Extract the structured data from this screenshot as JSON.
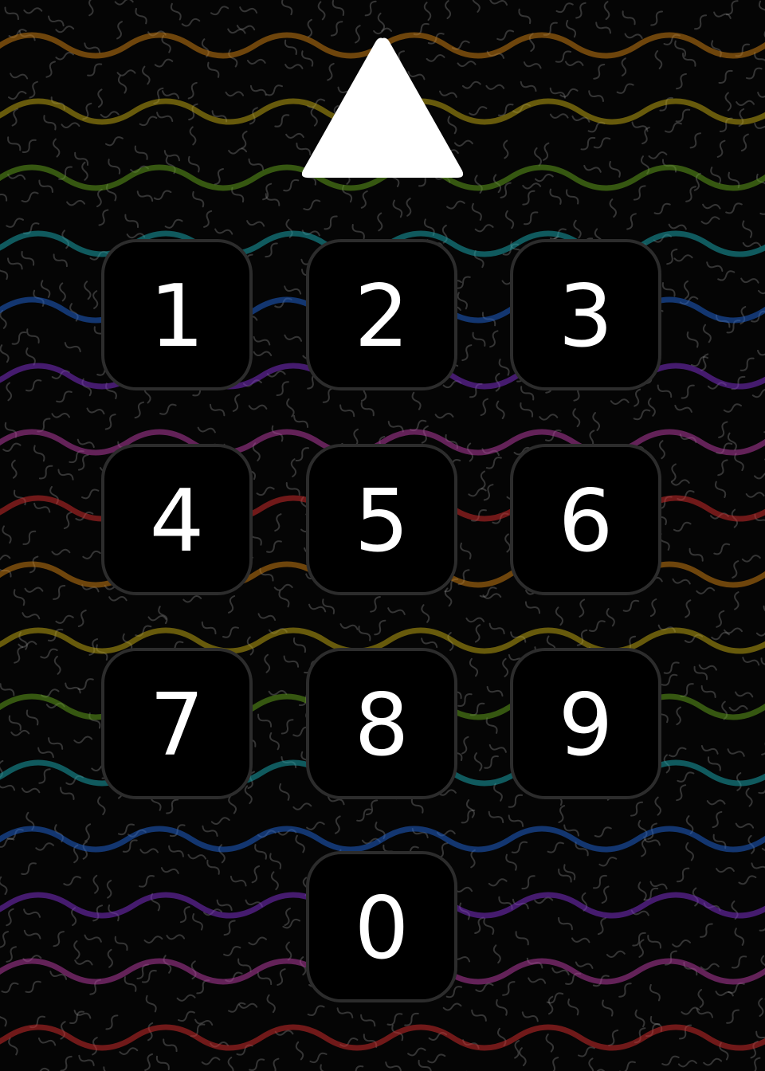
{
  "background": {
    "wave_colors": [
      "#c47a12",
      "#b8a012",
      "#5e9a1c",
      "#1aa0a8",
      "#1f5fc8",
      "#7a2ec4",
      "#b03a9c",
      "#c82a2a",
      "#c47a12",
      "#b8a012",
      "#5e9a1c",
      "#1aa0a8",
      "#1f5fc8",
      "#7a2ec4",
      "#b03a9c",
      "#c82a2a"
    ],
    "squiggle_color": "#9a9a9a"
  },
  "up_arrow": {
    "icon": "up-triangle-icon",
    "color": "#ffffff"
  },
  "keypad": {
    "keys": [
      {
        "id": "1",
        "label": "1"
      },
      {
        "id": "2",
        "label": "2"
      },
      {
        "id": "3",
        "label": "3"
      },
      {
        "id": "4",
        "label": "4"
      },
      {
        "id": "5",
        "label": "5"
      },
      {
        "id": "6",
        "label": "6"
      },
      {
        "id": "7",
        "label": "7"
      },
      {
        "id": "8",
        "label": "8"
      },
      {
        "id": "9",
        "label": "9"
      },
      {
        "id": "0",
        "label": "0"
      }
    ],
    "key_border_color": "#2c2c2c",
    "key_text_color": "#ffffff"
  }
}
